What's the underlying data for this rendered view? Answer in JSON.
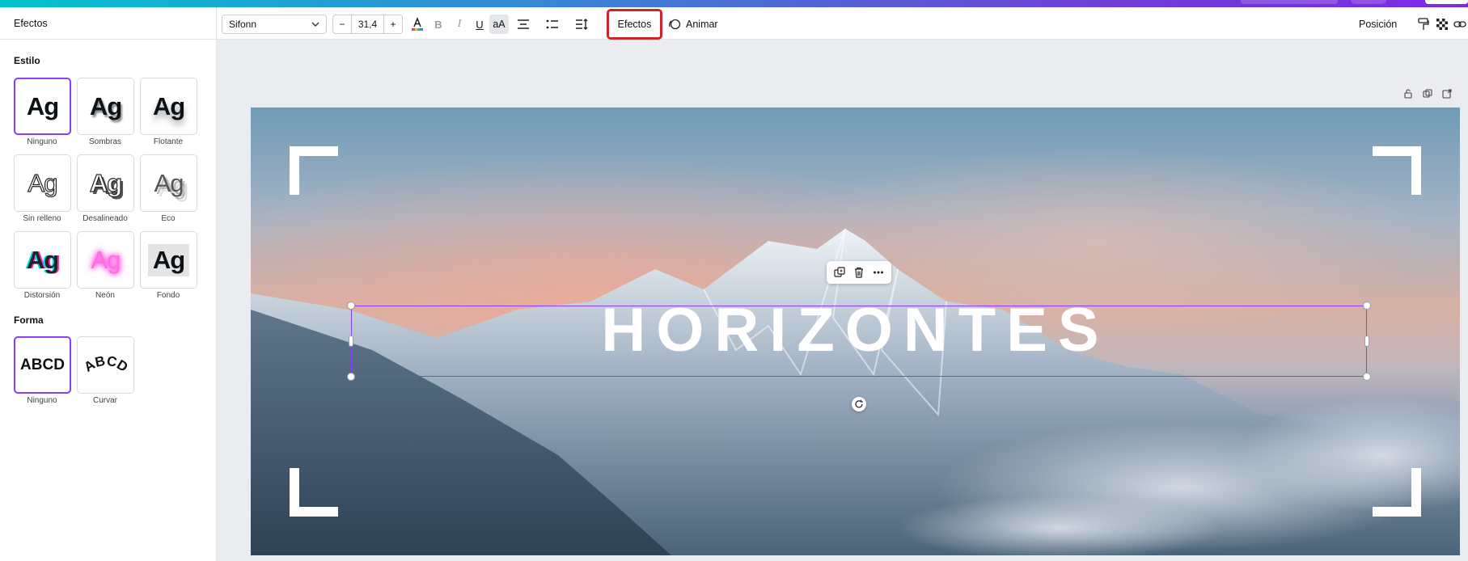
{
  "sidebar": {
    "title": "Efectos",
    "estilo_title": "Estilo",
    "forma_title": "Forma",
    "sample_text": "Ag",
    "shape_sample_text": "ABCD",
    "styles": [
      {
        "label": "Ninguno"
      },
      {
        "label": "Sombras"
      },
      {
        "label": "Flotante"
      },
      {
        "label": "Sin relleno"
      },
      {
        "label": "Desalineado"
      },
      {
        "label": "Eco"
      },
      {
        "label": "Distorsión"
      },
      {
        "label": "Neón"
      },
      {
        "label": "Fondo"
      }
    ],
    "shapes": [
      {
        "label": "Ninguno"
      },
      {
        "label": "Curvar"
      }
    ]
  },
  "toolbar": {
    "font": "Sifonn",
    "font_size": "31,4",
    "minus": "−",
    "plus": "+",
    "bold": "B",
    "italic": "I",
    "underline": "U",
    "case": "aA",
    "efectos": "Efectos",
    "animar": "Animar",
    "posicion": "Posición"
  },
  "canvas": {
    "headline": "HORIZONTES"
  },
  "colors": {
    "accent": "#8b3dff",
    "highlight_box": "#d3212b"
  }
}
